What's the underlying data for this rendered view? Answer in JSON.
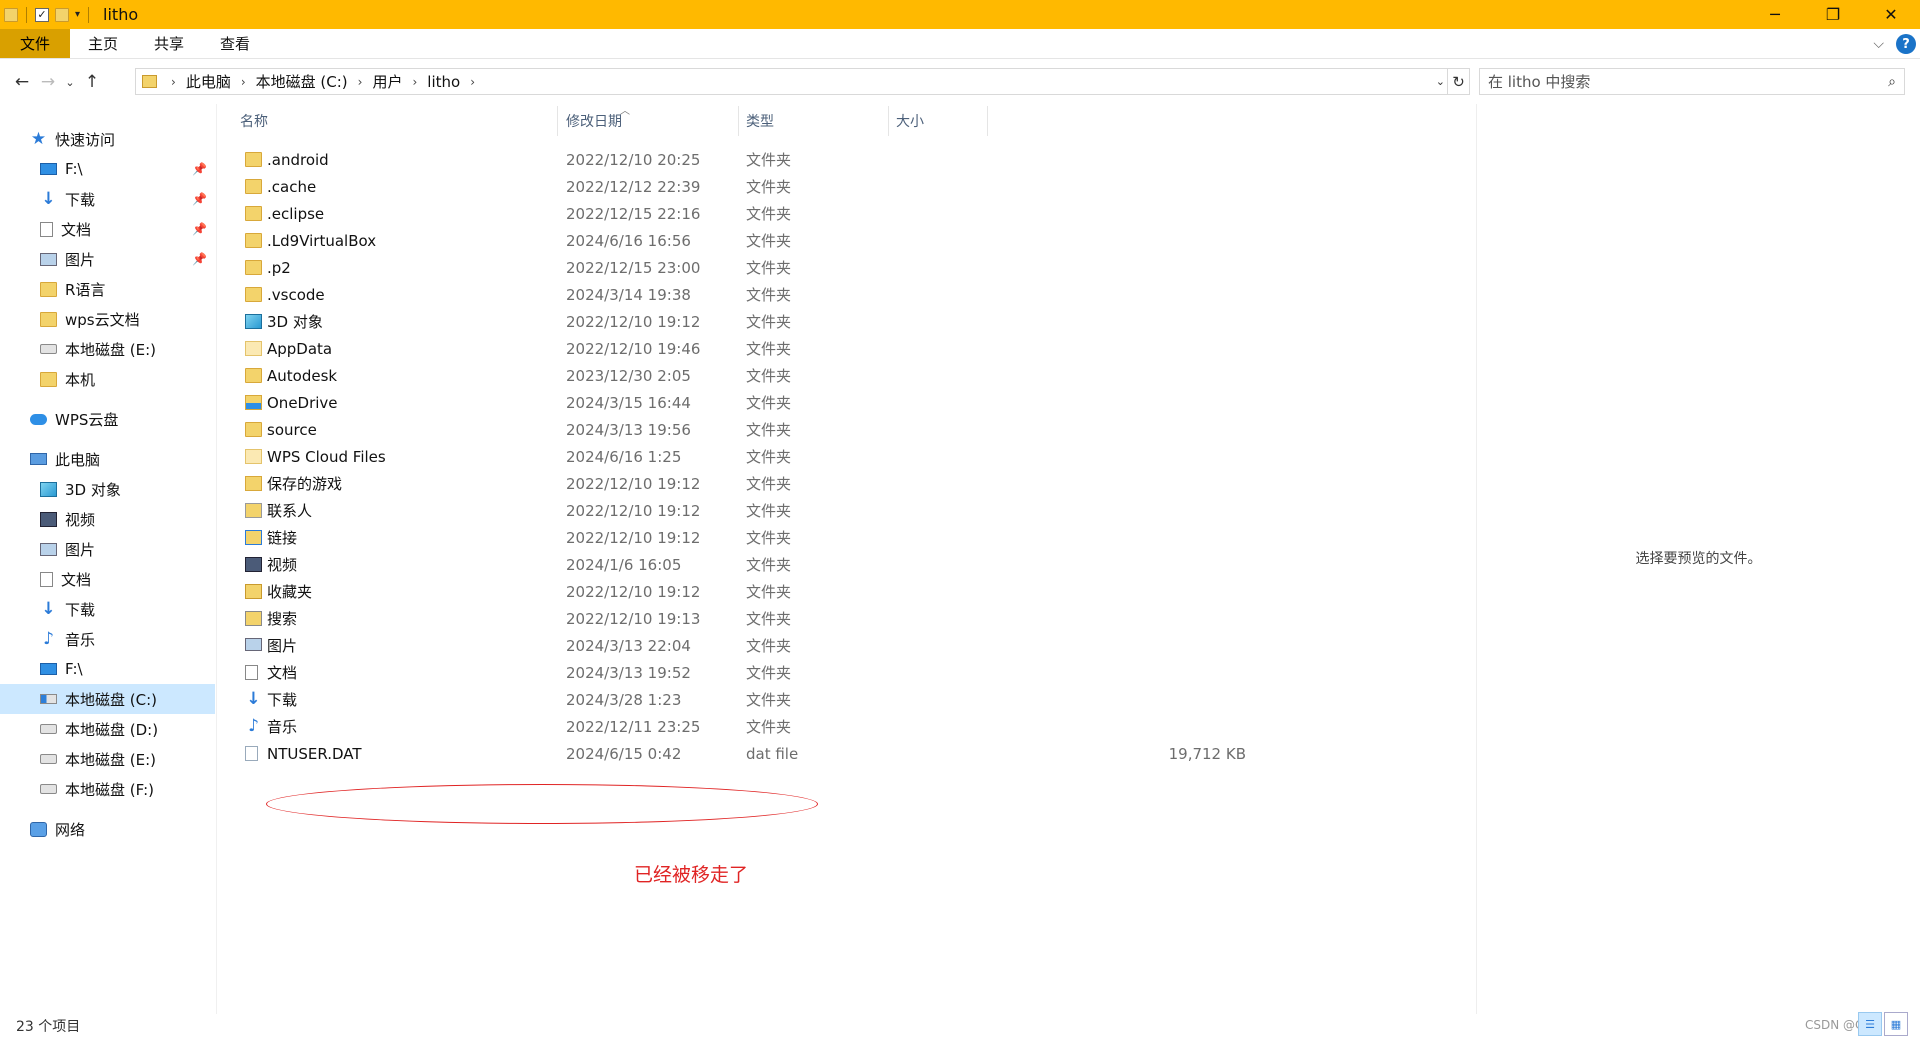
{
  "window": {
    "title": "litho"
  },
  "ribbon": {
    "tabs": [
      "文件",
      "主页",
      "共享",
      "查看"
    ]
  },
  "address": {
    "crumbs": [
      "此电脑",
      "本地磁盘 (C:)",
      "用户",
      "litho"
    ],
    "search_placeholder": "在 litho 中搜索"
  },
  "nav": {
    "quick_access": "快速访问",
    "quick_items": [
      {
        "label": "F:\\",
        "icon": "desktop-icon",
        "pinned": true
      },
      {
        "label": "下载",
        "icon": "download-icon",
        "pinned": true
      },
      {
        "label": "文档",
        "icon": "document-icon",
        "pinned": true
      },
      {
        "label": "图片",
        "icon": "pictures-icon",
        "pinned": true
      },
      {
        "label": "R语言",
        "icon": "folder-icon",
        "pinned": false
      },
      {
        "label": "wps云文档",
        "icon": "folder-icon",
        "pinned": false
      },
      {
        "label": "本地磁盘 (E:)",
        "icon": "drive-icon",
        "pinned": false
      },
      {
        "label": "本机",
        "icon": "folder-icon",
        "pinned": false
      }
    ],
    "wps_cloud": "WPS云盘",
    "this_pc": "此电脑",
    "pc_items": [
      {
        "label": "3D 对象",
        "icon": "3d-objects-icon"
      },
      {
        "label": "视频",
        "icon": "video-icon"
      },
      {
        "label": "图片",
        "icon": "pictures-icon"
      },
      {
        "label": "文档",
        "icon": "document-icon"
      },
      {
        "label": "下载",
        "icon": "download-icon"
      },
      {
        "label": "音乐",
        "icon": "music-icon"
      },
      {
        "label": "F:\\",
        "icon": "desktop-icon"
      },
      {
        "label": "本地磁盘 (C:)",
        "icon": "drive-c-icon",
        "selected": true
      },
      {
        "label": "本地磁盘 (D:)",
        "icon": "drive-icon"
      },
      {
        "label": "本地磁盘 (E:)",
        "icon": "drive-icon"
      },
      {
        "label": "本地磁盘 (F:)",
        "icon": "drive-icon"
      }
    ],
    "network": "网络"
  },
  "columns": {
    "name": "名称",
    "date": "修改日期",
    "type": "类型",
    "size": "大小"
  },
  "files": [
    {
      "name": ".android",
      "date": "2022/12/10 20:25",
      "type": "文件夹",
      "size": "",
      "icon": "folder-icon"
    },
    {
      "name": ".cache",
      "date": "2022/12/12 22:39",
      "type": "文件夹",
      "size": "",
      "icon": "folder-icon"
    },
    {
      "name": ".eclipse",
      "date": "2022/12/15 22:16",
      "type": "文件夹",
      "size": "",
      "icon": "folder-icon"
    },
    {
      "name": ".Ld9VirtualBox",
      "date": "2024/6/16 16:56",
      "type": "文件夹",
      "size": "",
      "icon": "folder-icon"
    },
    {
      "name": ".p2",
      "date": "2022/12/15 23:00",
      "type": "文件夹",
      "size": "",
      "icon": "folder-icon"
    },
    {
      "name": ".vscode",
      "date": "2024/3/14 19:38",
      "type": "文件夹",
      "size": "",
      "icon": "folder-icon"
    },
    {
      "name": "3D 对象",
      "date": "2022/12/10 19:12",
      "type": "文件夹",
      "size": "",
      "icon": "3d-objects-icon"
    },
    {
      "name": "AppData",
      "date": "2022/12/10 19:46",
      "type": "文件夹",
      "size": "",
      "icon": "folder-pale-icon"
    },
    {
      "name": "Autodesk",
      "date": "2023/12/30 2:05",
      "type": "文件夹",
      "size": "",
      "icon": "folder-icon"
    },
    {
      "name": "OneDrive",
      "date": "2024/3/15 16:44",
      "type": "文件夹",
      "size": "",
      "icon": "onedrive-icon"
    },
    {
      "name": "source",
      "date": "2024/3/13 19:56",
      "type": "文件夹",
      "size": "",
      "icon": "folder-icon"
    },
    {
      "name": "WPS Cloud Files",
      "date": "2024/6/16 1:25",
      "type": "文件夹",
      "size": "",
      "icon": "folder-pale-icon"
    },
    {
      "name": "保存的游戏",
      "date": "2022/12/10 19:12",
      "type": "文件夹",
      "size": "",
      "icon": "saved-games-icon"
    },
    {
      "name": "联系人",
      "date": "2022/12/10 19:12",
      "type": "文件夹",
      "size": "",
      "icon": "contacts-icon"
    },
    {
      "name": "链接",
      "date": "2022/12/10 19:12",
      "type": "文件夹",
      "size": "",
      "icon": "links-icon"
    },
    {
      "name": "视频",
      "date": "2024/1/6 16:05",
      "type": "文件夹",
      "size": "",
      "icon": "video-icon"
    },
    {
      "name": "收藏夹",
      "date": "2022/12/10 19:12",
      "type": "文件夹",
      "size": "",
      "icon": "favorites-icon"
    },
    {
      "name": "搜索",
      "date": "2022/12/10 19:13",
      "type": "文件夹",
      "size": "",
      "icon": "searches-icon"
    },
    {
      "name": "图片",
      "date": "2024/3/13 22:04",
      "type": "文件夹",
      "size": "",
      "icon": "pictures-icon"
    },
    {
      "name": "文档",
      "date": "2024/3/13 19:52",
      "type": "文件夹",
      "size": "",
      "icon": "document-icon"
    },
    {
      "name": "下载",
      "date": "2024/3/28 1:23",
      "type": "文件夹",
      "size": "",
      "icon": "download-icon"
    },
    {
      "name": "音乐",
      "date": "2022/12/11 23:25",
      "type": "文件夹",
      "size": "",
      "icon": "music-icon"
    },
    {
      "name": "NTUSER.DAT",
      "date": "2024/6/15 0:42",
      "type": "dat file",
      "size": "19,712 KB",
      "icon": "dat-file-icon"
    }
  ],
  "preview_text": "选择要预览的文件。",
  "annotation": {
    "text": "已经被移走了",
    "color": "#e02424"
  },
  "status": {
    "count": "23 个项目"
  },
  "watermark": "CSDN @C",
  "colors": {
    "titlebar": "#ffb900",
    "file_tab": "#d9a000",
    "selection": "#cce8ff"
  }
}
